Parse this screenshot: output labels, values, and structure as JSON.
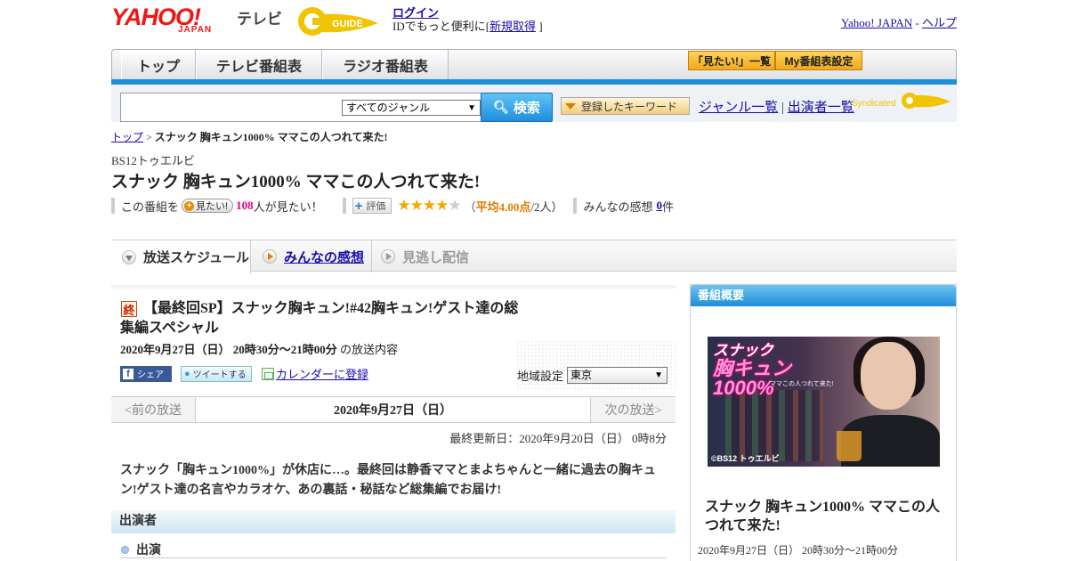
{
  "header": {
    "logo_yahoo": "YAHOO!",
    "logo_japan": "JAPAN",
    "logo_tv": "テレビ",
    "gguide_logo": "G GUIDE",
    "login": "ログイン",
    "id_prefix": "IDでもっと便利に[",
    "signup": "新規取得",
    "id_suffix": "]",
    "yahoo_japan": "Yahoo! JAPAN",
    "separator": "-",
    "help": "ヘルプ"
  },
  "nav": {
    "tabs": [
      "トップ",
      "テレビ番組表",
      "ラジオ番組表"
    ],
    "mitai_list": "「見たい!」一覧",
    "my_schedule": "My番組表設定"
  },
  "search": {
    "placeholder": "",
    "genre": "すべてのジャンル",
    "button": "検索",
    "keyword_button": "登録したキーワード",
    "genre_list": "ジャンル一覧",
    "divider": "|",
    "cast_list": "出演者一覧",
    "syndicated": "Syndicated"
  },
  "breadcrumb": {
    "top": "トップ",
    "sep": ">",
    "current": "スナック 胸キュン1000% ママこの人つれて来た!"
  },
  "program": {
    "channel": "BS12トゥエルビ",
    "title": "スナック 胸キュン1000% ママこの人つれて来た!",
    "mitai_prefix": "この番組を",
    "mitai_button": "見たい!",
    "mitai_count": "108",
    "mitai_suffix": "人が見たい！",
    "hyoka_button": "評価",
    "stars_filled": "★★★★",
    "stars_empty": "★",
    "rating_open": "（",
    "rating_avg": "平均4.00点",
    "rating_count": "/2人）",
    "impressions_label": "みんなの感想",
    "impressions_count": "0",
    "impressions_suffix": "件"
  },
  "tabs": {
    "schedule": "放送スケジュール",
    "impressions": "みんなの感想",
    "missed": "見逃し配信"
  },
  "episode": {
    "badge": "終",
    "title": "【最終回SP】スナック胸キュン!#42胸キュン!ゲスト達の総集編スペシャル",
    "date": "2020年9月27日（日）  20時30分～21時00分",
    "date_suffix": " の放送内容",
    "share_fb": "シェア",
    "share_tw": "ツイートする",
    "calendar": "カレンダーに登録",
    "region_label": "地域設定",
    "region": "東京",
    "prev": "<前の放送",
    "current_date": "2020年9月27日（日）",
    "next": "次の放送>",
    "updated": "最終更新日：2020年9月20日（日） 0時8分",
    "description": "スナック「胸キュン1000%」が休店に…。最終回は静香ママとまよちゃんと一緒に過去の胸キュン!ゲスト達の名言やカラオケ、あの裏話・秘話など総集編でお届け!",
    "cast_header": "出演者",
    "cast_item": "出演"
  },
  "sidebar": {
    "header": "番組概要",
    "thumb_title_a": "スナック",
    "thumb_title_b": "胸キュン1000%",
    "thumb_sub": "ママこの人つれて来た!",
    "thumb_copy": "©BS12 トゥエルビ",
    "title": "スナック 胸キュン1000% ママこの人つれて来た!",
    "date": "2020年9月27日（日） 20時30分～21時00分"
  },
  "colors": {
    "accent_blue": "#1e8fd5",
    "accent_orange": "#e07b00",
    "brand_red": "#f01616",
    "pink": "#e6007e"
  }
}
